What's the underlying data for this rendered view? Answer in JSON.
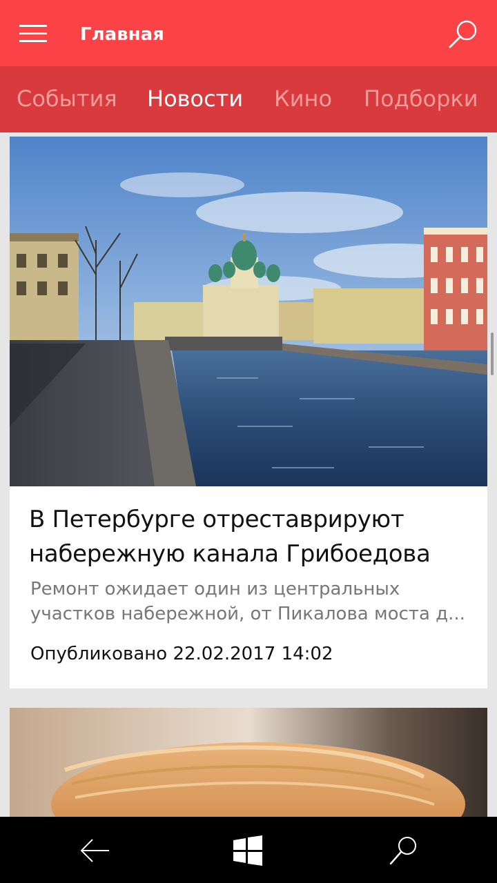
{
  "header": {
    "title": "Главная",
    "menu_icon": "hamburger-menu-icon",
    "search_icon": "search-icon"
  },
  "tabs": [
    {
      "label": "События",
      "active": false
    },
    {
      "label": "Новости",
      "active": true
    },
    {
      "label": "Кино",
      "active": false
    },
    {
      "label": "Подборки",
      "active": false
    }
  ],
  "feed": {
    "articles": [
      {
        "title_line1": "В Петербурге отреставрируют",
        "title_line2": "набережную канала Грибоедова",
        "summary_line1": "Ремонт ожидает один из центральных",
        "summary_line2": "участков набережной, от Пикалова моста д...",
        "published": "Опубликовано 22.02.2017 14:02"
      }
    ]
  },
  "navbar": {
    "back_icon": "back-arrow-icon",
    "windows_icon": "windows-start-icon",
    "search_icon": "search-icon"
  },
  "colors": {
    "titlebar": "#fb4347",
    "tabs": "#d83a3e",
    "tab_inactive": "#f39c9c",
    "feed_bg": "#e6e6e6"
  }
}
